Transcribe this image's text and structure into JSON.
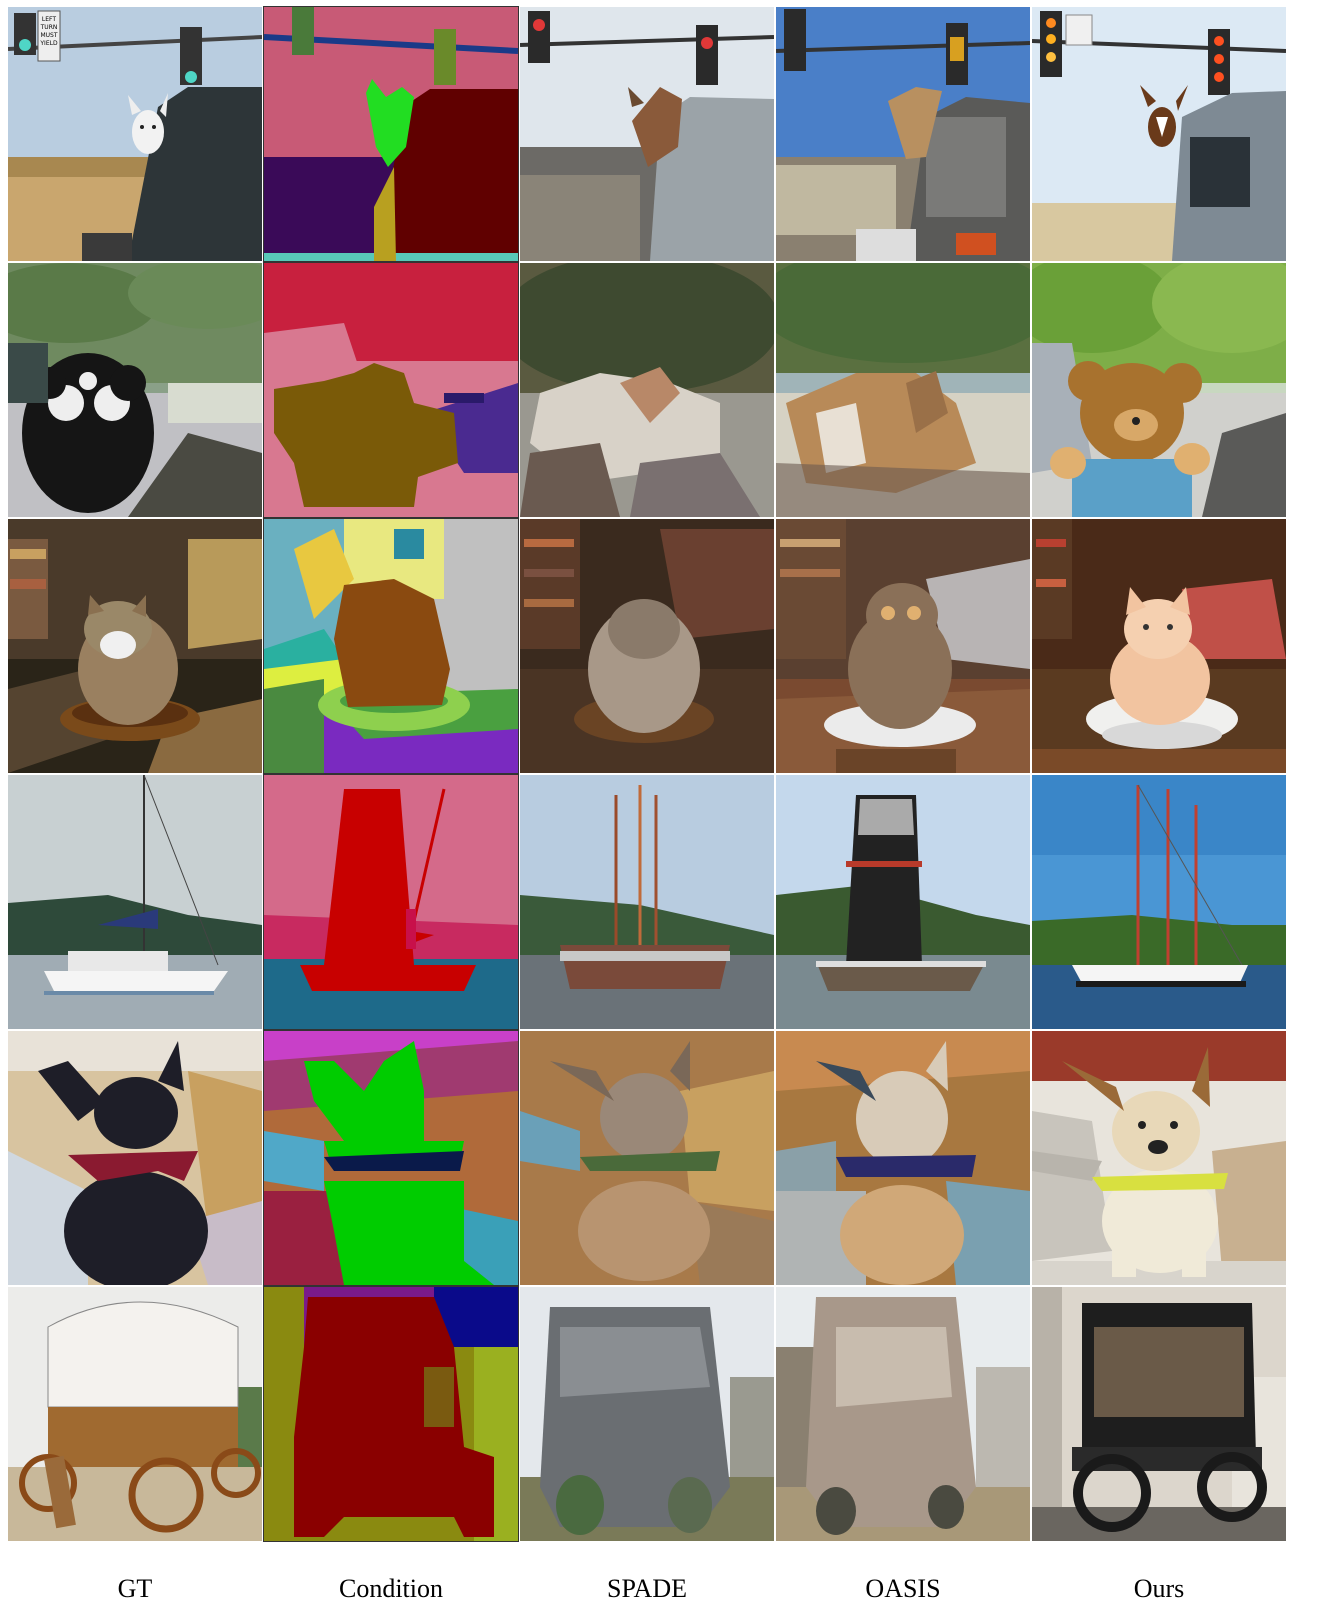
{
  "columns": [
    "GT",
    "Condition",
    "SPADE",
    "OASIS",
    "Ours"
  ],
  "gt_sign_lines": [
    "LEFT",
    "TURN",
    "MUST",
    "YIELD"
  ],
  "rows": [
    {
      "id": "traffic-dog"
    },
    {
      "id": "teddy-bear"
    },
    {
      "id": "cat-plate"
    },
    {
      "id": "sailboat"
    },
    {
      "id": "dog-scarf"
    },
    {
      "id": "wagon"
    }
  ]
}
